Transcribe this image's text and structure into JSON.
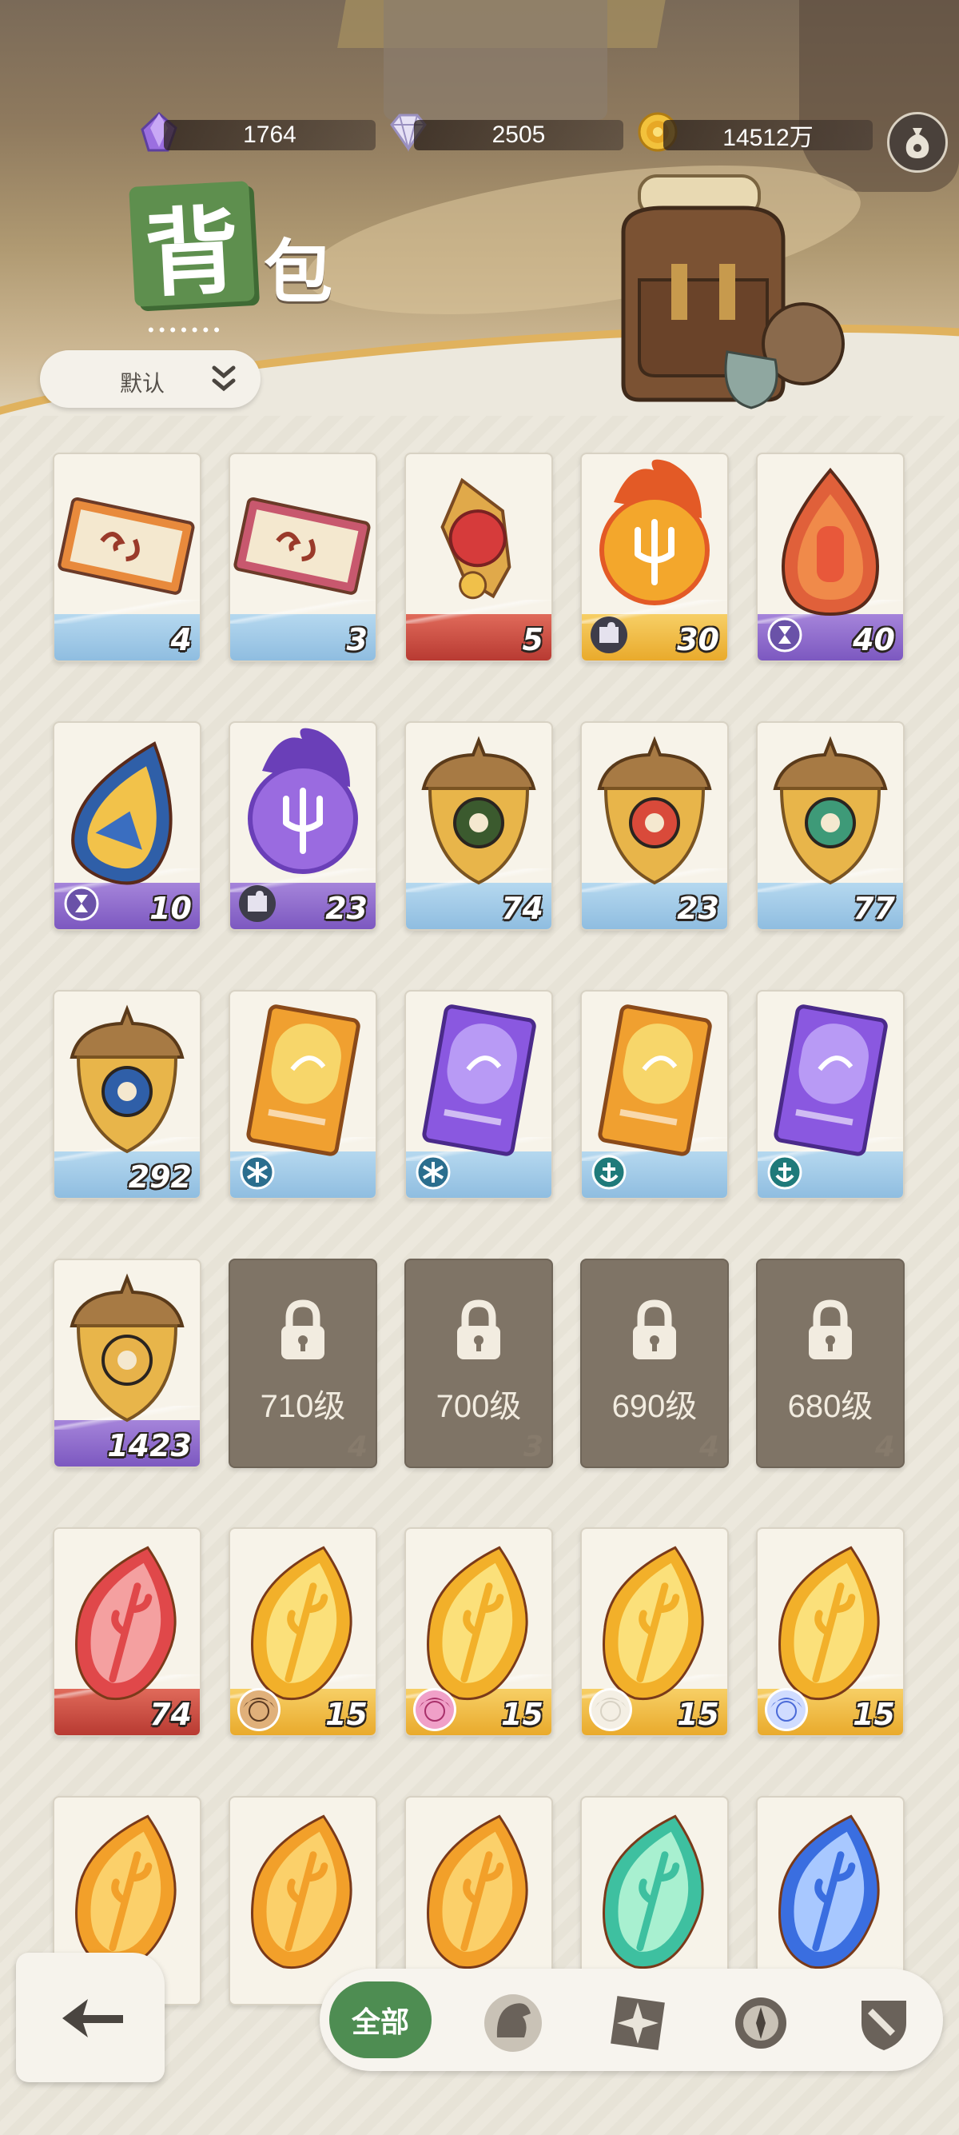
{
  "currency": [
    {
      "icon": "purple-crystal-icon",
      "value": "1764"
    },
    {
      "icon": "diamond-icon",
      "value": "2505"
    },
    {
      "icon": "gold-coin-icon",
      "value": "14512万"
    }
  ],
  "title": {
    "char1": "背",
    "char2": "包"
  },
  "sort": {
    "label": "默认"
  },
  "items": [
    {
      "name": "orange-ticket",
      "count": "4",
      "band": "blue"
    },
    {
      "name": "pink-ticket",
      "count": "3",
      "band": "blue"
    },
    {
      "name": "red-medallion",
      "count": "5",
      "band": "red"
    },
    {
      "name": "fire-trident-orb",
      "count": "30",
      "band": "gold",
      "badge": "puzzle"
    },
    {
      "name": "fire-drop-crest",
      "count": "40",
      "band": "purple",
      "badge": "hourglass"
    },
    {
      "name": "golden-drop-crest",
      "count": "10",
      "band": "purple",
      "badge": "hourglass"
    },
    {
      "name": "purple-trident-orb",
      "count": "23",
      "band": "purple",
      "badge": "puzzle"
    },
    {
      "name": "acorn-green-eye",
      "count": "74",
      "band": "blue"
    },
    {
      "name": "acorn-red-target",
      "count": "23",
      "band": "blue"
    },
    {
      "name": "acorn-green-leaf",
      "count": "77",
      "band": "blue"
    },
    {
      "name": "acorn-blue-star",
      "count": "292",
      "band": "blue"
    },
    {
      "name": "gold-card-snowflake",
      "count": "",
      "band": "blue",
      "badge": "snowflake"
    },
    {
      "name": "purple-card-snowflake",
      "count": "",
      "band": "blue",
      "badge": "snowflake"
    },
    {
      "name": "gold-card-anchor",
      "count": "",
      "band": "blue",
      "badge": "anchor"
    },
    {
      "name": "purple-card-anchor",
      "count": "",
      "band": "blue",
      "badge": "anchor"
    },
    {
      "name": "acorn-diamond",
      "count": "1423",
      "band": "purple"
    },
    {
      "name": "locked-chest",
      "count": "4",
      "locked": true,
      "level": "710级"
    },
    {
      "name": "locked-chest",
      "count": "3",
      "locked": true,
      "level": "700级"
    },
    {
      "name": "locked-chest",
      "count": "4",
      "locked": true,
      "level": "690级"
    },
    {
      "name": "locked-chest",
      "count": "4",
      "locked": true,
      "level": "680级"
    },
    {
      "name": "red-leaf-rune",
      "count": "74",
      "band": "red"
    },
    {
      "name": "gold-leaf-rune-hero1",
      "count": "15",
      "band": "gold",
      "badge": "avatar1"
    },
    {
      "name": "gold-leaf-rune-hero2",
      "count": "15",
      "band": "gold",
      "badge": "avatar2"
    },
    {
      "name": "gold-leaf-rune-hero3",
      "count": "15",
      "band": "gold",
      "badge": "avatar3"
    },
    {
      "name": "gold-leaf-rune-hero4",
      "count": "15",
      "band": "gold",
      "badge": "avatar4"
    },
    {
      "name": "orange-leaf-rune",
      "count": "",
      "band": "none"
    },
    {
      "name": "orange-leaf-rune",
      "count": "",
      "band": "none"
    },
    {
      "name": "orange-leaf-rune",
      "count": "",
      "band": "none"
    },
    {
      "name": "green-leaf-rune",
      "count": "",
      "band": "none"
    },
    {
      "name": "blue-leaf-rune",
      "count": "",
      "band": "none"
    }
  ],
  "tabs": {
    "all_label": "全部",
    "icons": [
      "hero-helmet-icon",
      "star-emblem-icon",
      "compass-icon",
      "sword-shield-icon"
    ]
  },
  "colors": {
    "accent_green": "#4e8d52",
    "band_blue": "#9ec8e6",
    "band_purple": "#8c6dc8",
    "band_red": "#c8473c",
    "band_gold": "#f0c04a"
  }
}
